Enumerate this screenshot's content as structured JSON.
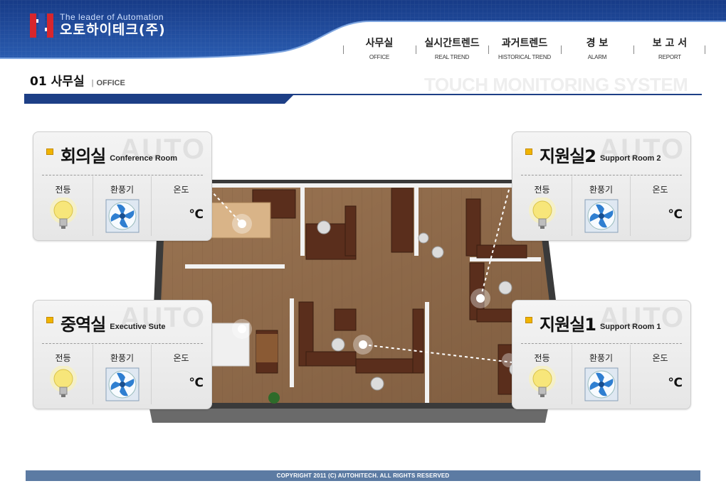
{
  "brand": {
    "tagline": "The leader of Automation",
    "name": "오토하이테크(주)"
  },
  "nav": [
    {
      "ko": "사무실",
      "en": "OFFICE"
    },
    {
      "ko": "실시간트렌드",
      "en": "REAL TREND"
    },
    {
      "ko": "과거트렌드",
      "en": "HISTORICAL TREND"
    },
    {
      "ko": "경 보",
      "en": "ALARM"
    },
    {
      "ko": "보 고 서",
      "en": "REPORT"
    }
  ],
  "page": {
    "number": "01",
    "title_ko": "사무실",
    "separator": "|",
    "title_en": "OFFICE",
    "system_title": "TOUCH MONITORING SYSTEM"
  },
  "watermark": "AUTO",
  "rooms": [
    {
      "ko": "회의실",
      "en": "Conference Room",
      "light_label": "전등",
      "fan_label": "환풍기",
      "temp_label": "온도",
      "temp_unit": "℃"
    },
    {
      "ko": "지원실2",
      "en": "Support Room 2",
      "light_label": "전등",
      "fan_label": "환풍기",
      "temp_label": "온도",
      "temp_unit": "℃"
    },
    {
      "ko": "중역실",
      "en": "Executive Sute",
      "light_label": "전등",
      "fan_label": "환풍기",
      "temp_label": "온도",
      "temp_unit": "℃"
    },
    {
      "ko": "지원실1",
      "en": "Support Room 1",
      "light_label": "전등",
      "fan_label": "환풍기",
      "temp_label": "온도",
      "temp_unit": "℃"
    }
  ],
  "footer": "COPYRIGHT 2011  (C) AUTOHITECH. ALL RIGHTS RESERVED",
  "colors": {
    "header_navy": "#1d3f86",
    "brand_red": "#d8262c",
    "footer_bar": "#5c7ba3",
    "bulb_yellow": "#f7e67a",
    "fan_blue": "#2f7fd1"
  }
}
